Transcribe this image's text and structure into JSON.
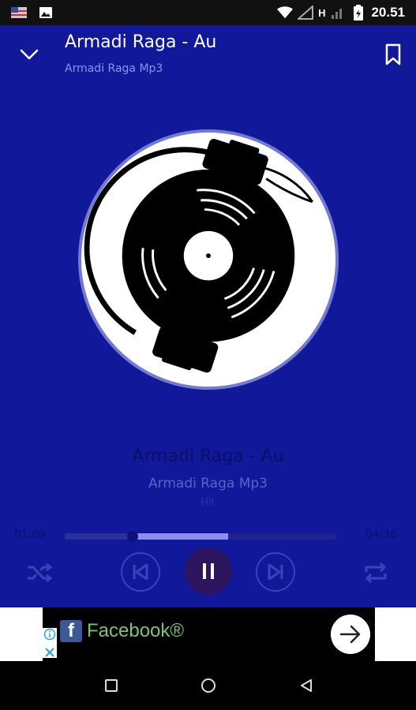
{
  "status_bar": {
    "time": "20.51",
    "network": "H",
    "icons": [
      "flag-icon",
      "image-icon",
      "wifi-icon",
      "signal-empty-icon",
      "signal-icon",
      "battery-icon"
    ]
  },
  "header": {
    "title": "Armadi Raga - Au",
    "subtitle": "Armadi Raga Mp3",
    "collapse_icon": "chevron-down-icon",
    "bookmark_icon": "bookmark-icon"
  },
  "album_art": {
    "icon": "vinyl-turntable-icon"
  },
  "now_playing": {
    "title": "Armadi Raga - Au",
    "artist": "Armadi Raga Mp3",
    "extra": "Hit"
  },
  "progress": {
    "current_time": "01:09",
    "total_time": "04:36",
    "played_fraction": 0.25,
    "buffered_fraction": 0.6
  },
  "controls": {
    "shuffle_icon": "shuffle-icon",
    "previous_icon": "skip-previous-icon",
    "play_pause_icon": "pause-icon",
    "next_icon": "skip-next-icon",
    "repeat_icon": "repeat-icon"
  },
  "ad": {
    "brand": "Facebook®",
    "info_icon": "info-icon",
    "close_icon": "close-icon",
    "cta_icon": "arrow-right-icon"
  },
  "nav_bar": {
    "icons": [
      "recents-square-icon",
      "home-circle-icon",
      "back-triangle-icon"
    ]
  },
  "colors": {
    "player_background": "#11189a",
    "accent": "#8a8ff0",
    "title_dark": "#0b1066",
    "subtitle": "#8c93e8"
  }
}
